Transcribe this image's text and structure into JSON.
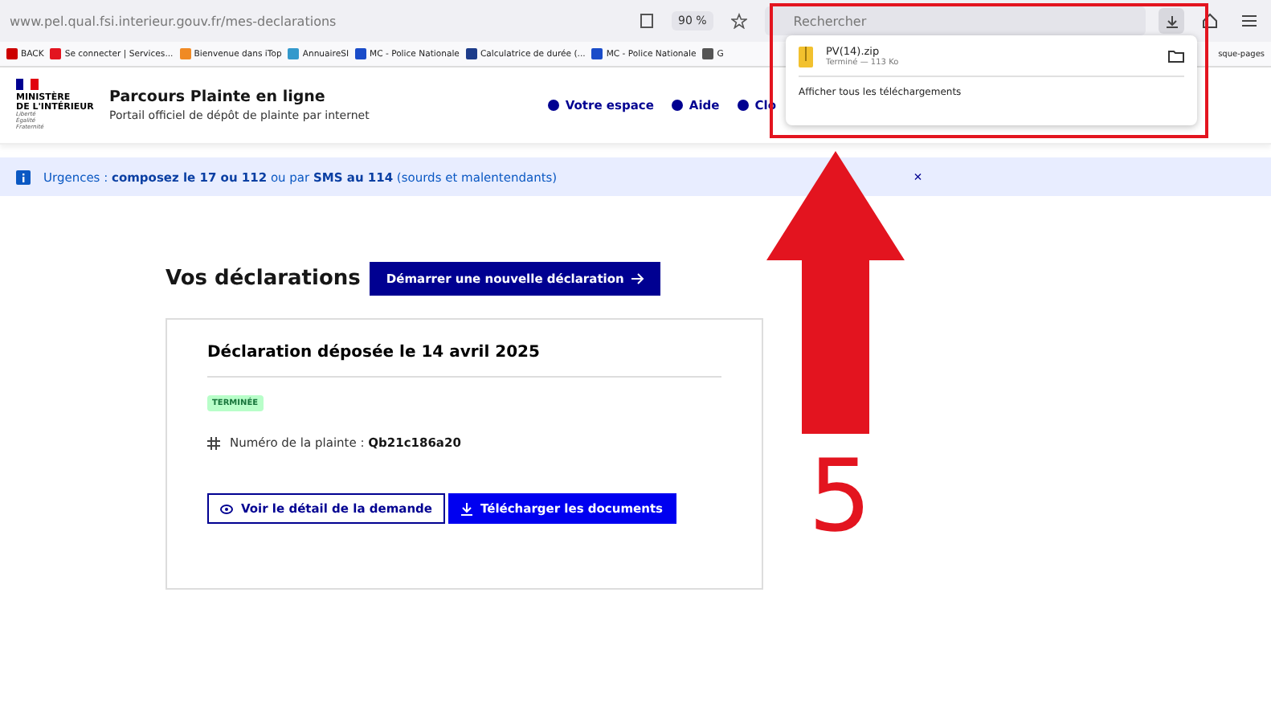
{
  "browser": {
    "url": "www.pel.qual.fsi.interieur.gouv.fr/mes-declarations",
    "zoom": "90 %",
    "search_placeholder": "Rechercher",
    "bookmarks": [
      "BACK",
      "Se connecter | Services...",
      "Bienvenue dans iTop",
      "AnnuaireSI",
      "MC - Police Nationale",
      "Calculatrice de durée (...",
      "MC - Police Nationale",
      "G"
    ],
    "bookmarks_end": "sque-pages"
  },
  "downloads_panel": {
    "file": "PV(14).zip",
    "status": "Terminé — 113 Ko",
    "show_all": "Afficher tous les téléchargements"
  },
  "site_header": {
    "logo": [
      "MINISTÈRE",
      "DE L'INTÉRIEUR"
    ],
    "logo_motto": [
      "Liberté",
      "Égalité",
      "Fraternité"
    ],
    "title": "Parcours Plainte en ligne",
    "subtitle": "Portail officiel de dépôt de plainte par internet",
    "nav": [
      "Votre espace",
      "Aide",
      "Clo"
    ]
  },
  "alert": {
    "text": "Urgences : **composez le 17 ou 112** ou par **SMS au 114** (sourds et malentendants)",
    "close": "×"
  },
  "page": {
    "heading": "Vos déclarations",
    "new_button": "Démarrer une nouvelle déclaration"
  },
  "declarations": [
    {
      "title": "Déclaration déposée le 14 avril 2025",
      "status": "TERMINÉE",
      "number_label": "Numéro de la plainte :",
      "number": "Qb21c186a20",
      "details_button": "Voir le détail de la demande",
      "download_button": "Télécharger les documents"
    }
  ],
  "annotation": {
    "step": "5"
  }
}
